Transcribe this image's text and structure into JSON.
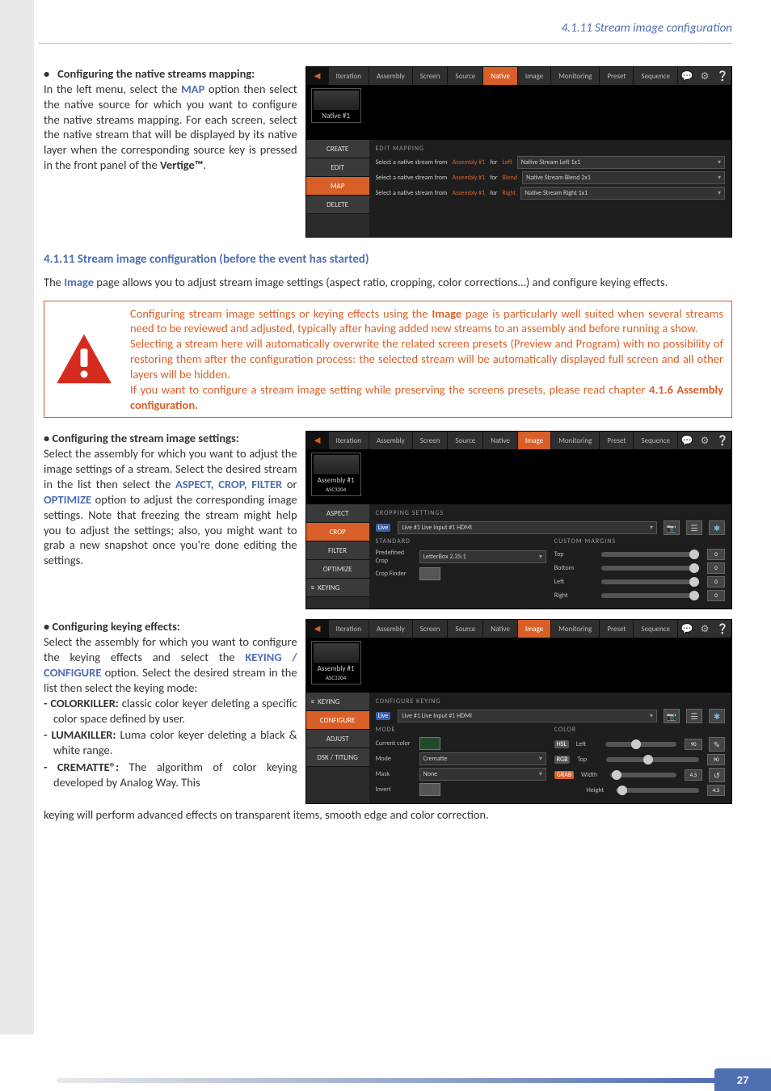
{
  "header": {
    "breadcrumb": "4.1.11 Stream image configuration"
  },
  "sec1": {
    "title": "Configuring the native streams mapping:",
    "body_a": "In the left menu, select the ",
    "map": "MAP",
    "body_b": " option then select the native source for which you want to configure the native streams mapping. For each screen, select the native stream that will be displayed by its native layer when the corresponding source key is pressed in the front panel of the ",
    "product": "Vertige™",
    "body_c": "."
  },
  "shot1": {
    "tabs": [
      "Iteration",
      "Assembly",
      "Screen",
      "Source",
      "Native",
      "Image",
      "Monitoring",
      "Preset",
      "Sequence"
    ],
    "active_tab": "Native",
    "thumb_label": "Native #1",
    "side": [
      "CREATE",
      "EDIT",
      "MAP",
      "DELETE"
    ],
    "side_active": "MAP",
    "panel_title": "EDIT MAPPING",
    "rows": [
      {
        "prompt_a": "Select a native stream from",
        "prompt_asm": "Assembly #1",
        "prompt_for": "for",
        "target": "Left",
        "value": "Native Stream Left 1x1"
      },
      {
        "prompt_a": "Select a native stream from",
        "prompt_asm": "Assembly #1",
        "prompt_for": "for",
        "target": "Blend",
        "value": "Native Stream Blend 2x1"
      },
      {
        "prompt_a": "Select a native stream from",
        "prompt_asm": "Assembly #1",
        "prompt_for": "for",
        "target": "Right",
        "value": "Native Stream Right 1x1"
      }
    ]
  },
  "sec_title": "4.1.11 Stream image configuration (before the event has started)",
  "intro_a": "The ",
  "intro_image": "Image",
  "intro_b": " page allows you to adjust stream image settings (aspect ratio, cropping, color corrections…) and configure keying effects.",
  "warn": {
    "p1_a": "Configuring stream image settings or keying effects using the ",
    "p1_image": "Image",
    "p1_b": " page is particularly well suited when several streams need to be reviewed and adjusted, typically after having added new streams to an assembly and before running a show.",
    "p2": "Selecting a stream here will automatically overwrite the related screen presets (Preview and Program) with no possibility of restoring them after the configuration process: the selected stream will be automatically displayed full screen and all other layers will be hidden.",
    "p3_a": "If you want to configure a stream image setting while preserving the screens presets, please read chapter ",
    "p3_ref": "4.1.6 Assembly configuration."
  },
  "sec3": {
    "title": "• Configuring the stream image settings:",
    "body_a": "Select the assembly for which you want to adjust the image settings of a stream. Select the desired stream in the list then select the ",
    "opts": "ASPECT, CROP, FILTER",
    "or": " or ",
    "opt2": "OPTIMIZE",
    "body_b": " option to adjust the corresponding image settings. Note that freezing the stream might help you to adjust the settings; also, you might want to grab a new snapshot once you're done editing the settings."
  },
  "shot2": {
    "tabs": [
      "Iteration",
      "Assembly",
      "Screen",
      "Source",
      "Native",
      "Image",
      "Monitoring",
      "Preset",
      "Sequence"
    ],
    "active_tab": "Image",
    "thumb_label": "Assembly #1",
    "thumb_sub": "ASC3204",
    "side": [
      "ASPECT",
      "CROP",
      "FILTER",
      "OPTIMIZE",
      "KEYING"
    ],
    "side_active": "CROP",
    "panel_title": "CROPPING SETTINGS",
    "stream_chip": "Live",
    "stream_name": "Live #1    Live    Input #1 HDMI",
    "standard_label": "STANDARD",
    "custom_label": "CUSTOM MARGINS",
    "predef_label": "Predefined Crop",
    "predef_value": "LetterBox 2.35:1",
    "cropfinder_label": "Crop Finder",
    "margins": [
      {
        "name": "Top",
        "val": "0"
      },
      {
        "name": "Bottom",
        "val": "0"
      },
      {
        "name": "Left",
        "val": "0"
      },
      {
        "name": "Right",
        "val": "0"
      }
    ]
  },
  "sec4": {
    "title": "• Configuring keying effects:",
    "body_a": "Select the assembly for which you want to configure the keying effects and select the ",
    "opt": "KEYING / CONFIGURE",
    "body_b": " option. Select the desired stream in the list then select the keying mode:",
    "items": [
      {
        "name": "- COLORKILLER:",
        "desc": " classic color keyer deleting a specific color space defined by user."
      },
      {
        "name": "- LUMAKILLER:",
        "desc": " Luma color keyer deleting a black & white range."
      },
      {
        "name": "- CREMATTE®:",
        "desc": " The algorithm of color keying developed by Analog Way. This"
      }
    ],
    "tail": "keying will perform advanced effects on transparent items, smooth edge and color correction."
  },
  "shot3": {
    "tabs": [
      "Iteration",
      "Assembly",
      "Screen",
      "Source",
      "Native",
      "Image",
      "Monitoring",
      "Preset",
      "Sequence"
    ],
    "active_tab": "Image",
    "thumb_label": "Assembly #1",
    "thumb_sub": "ASC3204",
    "side": [
      "KEYING",
      "CONFIGURE",
      "ADJUST",
      "DSK / TITLING"
    ],
    "side_active": "CONFIGURE",
    "panel_title": "CONFIGURE KEYING",
    "stream_chip": "Live",
    "stream_name": "Live #1    Live    Input #1 HDMI",
    "mode_hdr": "MODE",
    "color_hdr": "COLOR",
    "current_color": "Current color",
    "mode_label": "Mode",
    "mode_value": "Crematte",
    "mask_label": "Mask",
    "mask_value": "None",
    "invert_label": "Invert",
    "hsl_row": {
      "tag": "HSL",
      "name": "Left",
      "val": "90"
    },
    "rgb_row": {
      "tag": "RGB",
      "name": "Top",
      "val": "90"
    },
    "grab_row": {
      "tag": "GRAB",
      "name": "Width",
      "val": "4.5"
    },
    "height_row": {
      "name": "Height",
      "val": "4.5"
    }
  },
  "page_number": "27"
}
